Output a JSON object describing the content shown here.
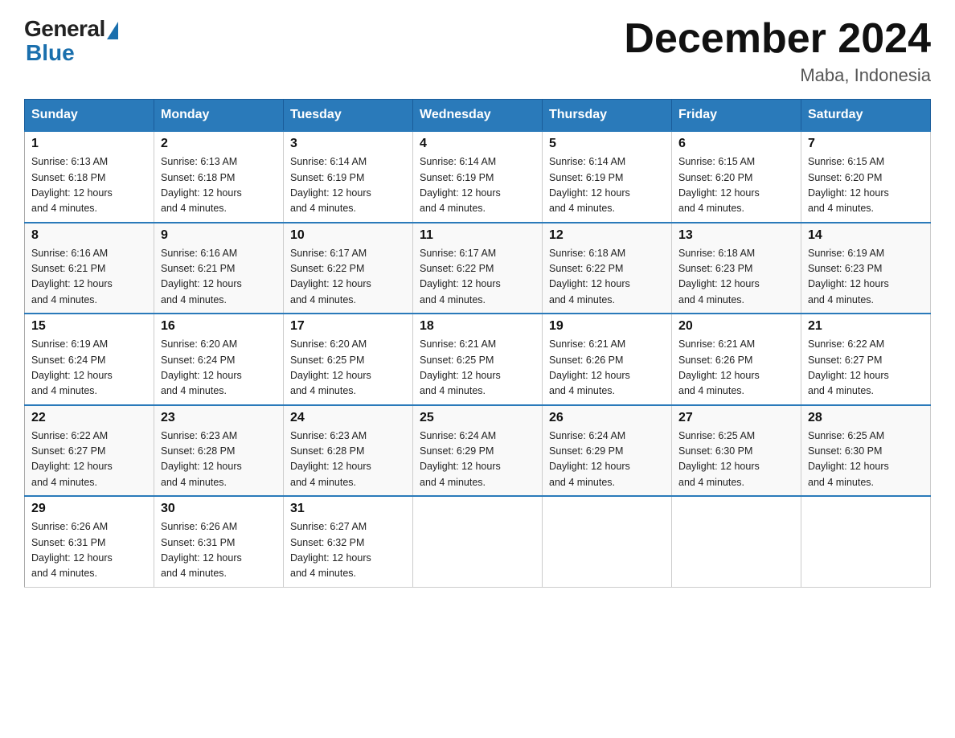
{
  "header": {
    "logo_general": "General",
    "logo_blue": "Blue",
    "month_title": "December 2024",
    "location": "Maba, Indonesia"
  },
  "days_of_week": [
    "Sunday",
    "Monday",
    "Tuesday",
    "Wednesday",
    "Thursday",
    "Friday",
    "Saturday"
  ],
  "weeks": [
    [
      {
        "day": "1",
        "sunrise": "6:13 AM",
        "sunset": "6:18 PM",
        "daylight": "12 hours and 4 minutes."
      },
      {
        "day": "2",
        "sunrise": "6:13 AM",
        "sunset": "6:18 PM",
        "daylight": "12 hours and 4 minutes."
      },
      {
        "day": "3",
        "sunrise": "6:14 AM",
        "sunset": "6:19 PM",
        "daylight": "12 hours and 4 minutes."
      },
      {
        "day": "4",
        "sunrise": "6:14 AM",
        "sunset": "6:19 PM",
        "daylight": "12 hours and 4 minutes."
      },
      {
        "day": "5",
        "sunrise": "6:14 AM",
        "sunset": "6:19 PM",
        "daylight": "12 hours and 4 minutes."
      },
      {
        "day": "6",
        "sunrise": "6:15 AM",
        "sunset": "6:20 PM",
        "daylight": "12 hours and 4 minutes."
      },
      {
        "day": "7",
        "sunrise": "6:15 AM",
        "sunset": "6:20 PM",
        "daylight": "12 hours and 4 minutes."
      }
    ],
    [
      {
        "day": "8",
        "sunrise": "6:16 AM",
        "sunset": "6:21 PM",
        "daylight": "12 hours and 4 minutes."
      },
      {
        "day": "9",
        "sunrise": "6:16 AM",
        "sunset": "6:21 PM",
        "daylight": "12 hours and 4 minutes."
      },
      {
        "day": "10",
        "sunrise": "6:17 AM",
        "sunset": "6:22 PM",
        "daylight": "12 hours and 4 minutes."
      },
      {
        "day": "11",
        "sunrise": "6:17 AM",
        "sunset": "6:22 PM",
        "daylight": "12 hours and 4 minutes."
      },
      {
        "day": "12",
        "sunrise": "6:18 AM",
        "sunset": "6:22 PM",
        "daylight": "12 hours and 4 minutes."
      },
      {
        "day": "13",
        "sunrise": "6:18 AM",
        "sunset": "6:23 PM",
        "daylight": "12 hours and 4 minutes."
      },
      {
        "day": "14",
        "sunrise": "6:19 AM",
        "sunset": "6:23 PM",
        "daylight": "12 hours and 4 minutes."
      }
    ],
    [
      {
        "day": "15",
        "sunrise": "6:19 AM",
        "sunset": "6:24 PM",
        "daylight": "12 hours and 4 minutes."
      },
      {
        "day": "16",
        "sunrise": "6:20 AM",
        "sunset": "6:24 PM",
        "daylight": "12 hours and 4 minutes."
      },
      {
        "day": "17",
        "sunrise": "6:20 AM",
        "sunset": "6:25 PM",
        "daylight": "12 hours and 4 minutes."
      },
      {
        "day": "18",
        "sunrise": "6:21 AM",
        "sunset": "6:25 PM",
        "daylight": "12 hours and 4 minutes."
      },
      {
        "day": "19",
        "sunrise": "6:21 AM",
        "sunset": "6:26 PM",
        "daylight": "12 hours and 4 minutes."
      },
      {
        "day": "20",
        "sunrise": "6:21 AM",
        "sunset": "6:26 PM",
        "daylight": "12 hours and 4 minutes."
      },
      {
        "day": "21",
        "sunrise": "6:22 AM",
        "sunset": "6:27 PM",
        "daylight": "12 hours and 4 minutes."
      }
    ],
    [
      {
        "day": "22",
        "sunrise": "6:22 AM",
        "sunset": "6:27 PM",
        "daylight": "12 hours and 4 minutes."
      },
      {
        "day": "23",
        "sunrise": "6:23 AM",
        "sunset": "6:28 PM",
        "daylight": "12 hours and 4 minutes."
      },
      {
        "day": "24",
        "sunrise": "6:23 AM",
        "sunset": "6:28 PM",
        "daylight": "12 hours and 4 minutes."
      },
      {
        "day": "25",
        "sunrise": "6:24 AM",
        "sunset": "6:29 PM",
        "daylight": "12 hours and 4 minutes."
      },
      {
        "day": "26",
        "sunrise": "6:24 AM",
        "sunset": "6:29 PM",
        "daylight": "12 hours and 4 minutes."
      },
      {
        "day": "27",
        "sunrise": "6:25 AM",
        "sunset": "6:30 PM",
        "daylight": "12 hours and 4 minutes."
      },
      {
        "day": "28",
        "sunrise": "6:25 AM",
        "sunset": "6:30 PM",
        "daylight": "12 hours and 4 minutes."
      }
    ],
    [
      {
        "day": "29",
        "sunrise": "6:26 AM",
        "sunset": "6:31 PM",
        "daylight": "12 hours and 4 minutes."
      },
      {
        "day": "30",
        "sunrise": "6:26 AM",
        "sunset": "6:31 PM",
        "daylight": "12 hours and 4 minutes."
      },
      {
        "day": "31",
        "sunrise": "6:27 AM",
        "sunset": "6:32 PM",
        "daylight": "12 hours and 4 minutes."
      },
      null,
      null,
      null,
      null
    ]
  ],
  "labels": {
    "sunrise": "Sunrise:",
    "sunset": "Sunset:",
    "daylight": "Daylight:"
  }
}
